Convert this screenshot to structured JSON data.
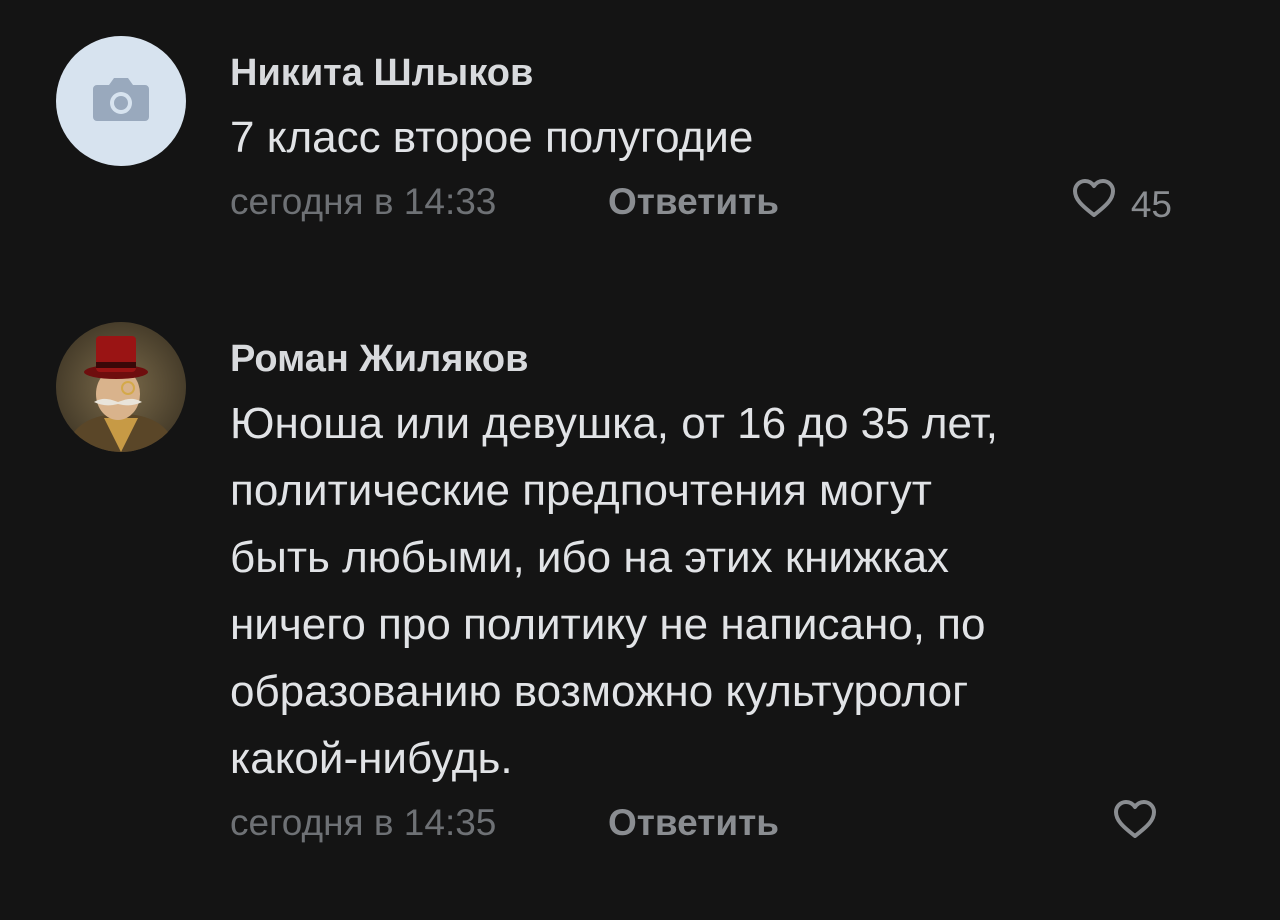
{
  "comments": [
    {
      "author": "Никита Шлыков",
      "text": "7 класс второе полугодие",
      "time": "сегодня в 14:33",
      "reply_label": "Ответить",
      "likes": "45",
      "avatar_icon": "camera-icon"
    },
    {
      "author": "Роман Жиляков",
      "text": "Юноша или девушка, от 16 до 35 лет,\nполитические предпочтения могут\nбыть любыми, ибо на этих книжках\nничего про политику не написано, по\nобразованию возможно культуролог\nкакой-нибудь.",
      "time": "сегодня в 14:35",
      "reply_label": "Ответить",
      "likes": "",
      "avatar_icon": "user-photo"
    }
  ],
  "colors": {
    "background": "#141414",
    "text": "#e1e3e6",
    "meta": "#6e7175",
    "accent_muted": "#8a8d91"
  }
}
